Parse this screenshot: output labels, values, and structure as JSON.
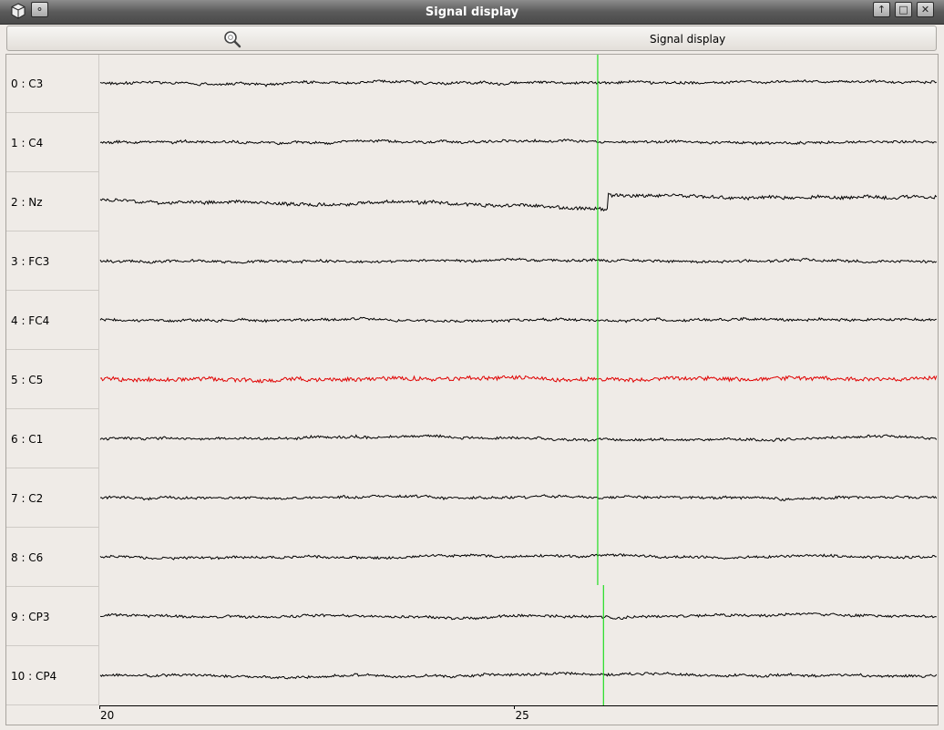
{
  "window": {
    "title": "Signal display"
  },
  "toolbar": {
    "zoom_icon": "zoom-magnifier-icon",
    "label": "Signal display"
  },
  "channels": [
    {
      "label": "0 : C3",
      "highlighted": false
    },
    {
      "label": "1 : C4",
      "highlighted": false
    },
    {
      "label": "2 : Nz",
      "highlighted": false
    },
    {
      "label": "3 : FC3",
      "highlighted": false
    },
    {
      "label": "4 : FC4",
      "highlighted": false
    },
    {
      "label": "5 : C5",
      "highlighted": true
    },
    {
      "label": "6 : C1",
      "highlighted": false
    },
    {
      "label": "7 : C2",
      "highlighted": false
    },
    {
      "label": "8 : C6",
      "highlighted": false
    },
    {
      "label": "9 : CP3",
      "highlighted": false
    },
    {
      "label": "10 : CP4",
      "highlighted": false
    }
  ],
  "time_axis": {
    "ticks": [
      {
        "label": "20",
        "value": 20
      },
      {
        "label": "25",
        "value": 25
      }
    ],
    "visible_range": [
      20,
      30.1
    ]
  },
  "marker": {
    "channels_0_8_time": 26.0,
    "channels_9_10_time": 26.07
  },
  "colors": {
    "signal": "#000000",
    "highlight_signal": "#e00000",
    "marker": "#22dd22",
    "background": "#efebe7"
  }
}
